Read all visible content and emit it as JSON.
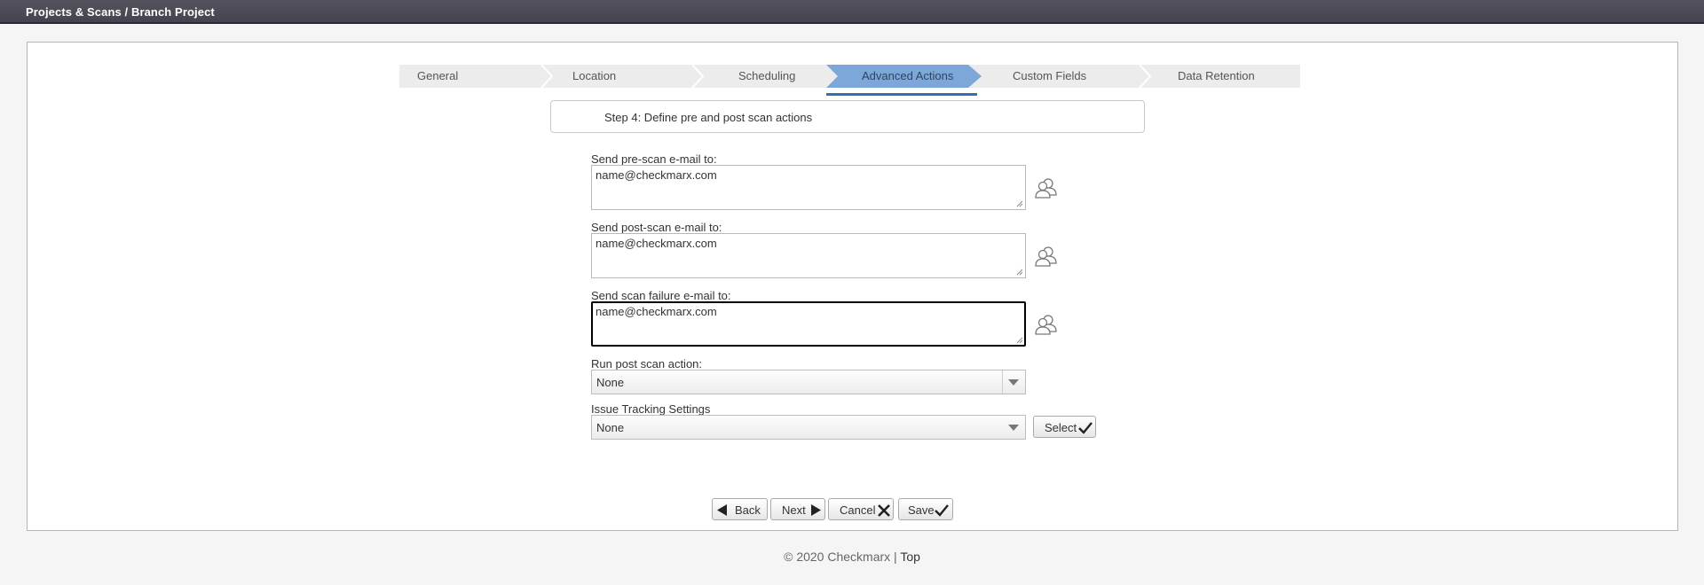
{
  "header": {
    "breadcrumb": "Projects & Scans / Branch Project"
  },
  "wizard": {
    "tabs": [
      {
        "label": "General"
      },
      {
        "label": "Location"
      },
      {
        "label": "Scheduling"
      },
      {
        "label": "Advanced Actions",
        "active": true
      },
      {
        "label": "Custom Fields"
      },
      {
        "label": "Data Retention"
      }
    ],
    "step_title": "Step 4: Define pre and post scan actions"
  },
  "form": {
    "pre_scan": {
      "label": "Send pre-scan e-mail to:",
      "value": "name@checkmarx.com"
    },
    "post_scan": {
      "label": "Send post-scan e-mail to:",
      "value": "name@checkmarx.com"
    },
    "failure": {
      "label": "Send scan failure e-mail to:",
      "value": "name@checkmarx.com"
    },
    "post_action": {
      "label": "Run post scan action:",
      "selected": "None"
    },
    "issue_tracking": {
      "label": "Issue Tracking Settings",
      "selected": "None",
      "select_button": "Select"
    }
  },
  "actions": {
    "back": "Back",
    "next": "Next",
    "cancel": "Cancel",
    "save": "Save"
  },
  "footer": {
    "copyright": "© 2020 Checkmarx |",
    "top_link": "Top"
  },
  "colors": {
    "active_tab": "#7da7d8",
    "active_underline": "#2f6fb2",
    "topbar": "#4b4955"
  }
}
